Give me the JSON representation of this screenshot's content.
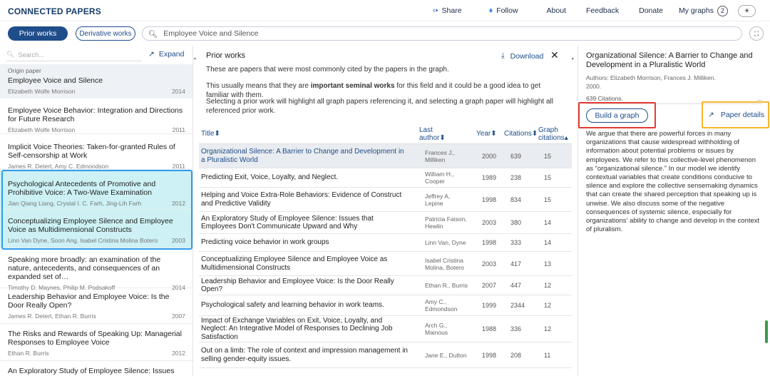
{
  "header": {
    "logo": "CONNECTED PAPERS",
    "share": "Share",
    "follow": "Follow",
    "about": "About",
    "feedback": "Feedback",
    "donate": "Donate",
    "my_graphs": "My graphs",
    "my_graphs_count": "2"
  },
  "toolbar": {
    "prior_works": "Prior works",
    "derivative_works": "Derivative works",
    "search_value": "Employee Voice and Silence"
  },
  "left": {
    "search_placeholder": "Search...",
    "expand": "Expand",
    "origin": {
      "label": "Origin paper",
      "title": "Employee Voice and Silence",
      "author": "Elizabeth Wolfe Morrison",
      "year": "2014"
    },
    "papers": [
      {
        "title": "Employee Voice Behavior: Integration and Directions for Future Research",
        "author": "Elizabeth Wolfe Morrison",
        "year": "2011"
      },
      {
        "title": "Implicit Voice Theories: Taken-for-granted Rules of Self-censorship at Work",
        "author": "James R. Detert, Amy C. Edmondson",
        "year": "2011"
      },
      {
        "title": "Psychological Antecedents of Promotive and Prohibitive Voice: A Two-Wave Examination",
        "author": "Jian Qiang Liang, Crystal I. C. Farh, Jing-Lih Farh",
        "year": "2012"
      },
      {
        "title": "Conceptualizing Employee Silence and Employee Voice as Multidimensional Constructs",
        "author": "Linn Van Dyne, Soon Ang, Isabel Cristina Molina Botero",
        "year": "2003"
      },
      {
        "title": "Speaking more broadly: an examination of the nature, antecedents, and consequences of an expanded set of…",
        "author": "Timothy D. Maynes, Philip M. Podsakoff",
        "year": "2014"
      },
      {
        "title": "Leadership Behavior and Employee Voice: Is the Door Really Open?",
        "author": "James R. Detert, Ethan R. Burris",
        "year": "2007"
      },
      {
        "title": "The Risks and Rewards of Speaking Up: Managerial Responses to Employee Voice",
        "author": "Ethan R. Burris",
        "year": "2012"
      },
      {
        "title": "An Exploratory Study of Employee Silence: Issues that",
        "author": "",
        "year": ""
      }
    ]
  },
  "mid": {
    "title": "Prior works",
    "download": "Download",
    "p1": "These are papers that were most commonly cited by the papers in the graph.",
    "p2_before": "This usually means that they are ",
    "p2_bold": "important seminal works",
    "p2_after": " for this field and it could be a good idea to get familiar with them.",
    "p3": "Selecting a prior work will highlight all graph papers referencing it, and selecting a graph paper will highlight all referenced prior work.",
    "columns": {
      "title": "Title",
      "author": "Last author",
      "year": "Year",
      "citations": "Citations",
      "graph": "Graph citations"
    },
    "rows": [
      {
        "title": "Organizational Silence: A Barrier to Change and Development in a Pluralistic World",
        "author": "Frances J., Milliken",
        "year": "2000",
        "citations": "639",
        "graph": "15"
      },
      {
        "title": "Predicting Exit, Voice, Loyalty, and Neglect.",
        "author": "William H., Cooper",
        "year": "1989",
        "citations": "238",
        "graph": "15"
      },
      {
        "title": "Helping and Voice Extra-Role Behaviors: Evidence of Construct and Predictive Validity",
        "author": "Jeffrey A, Lepine",
        "year": "1998",
        "citations": "834",
        "graph": "15"
      },
      {
        "title": "An Exploratory Study of Employee Silence: Issues that Employees Don't Communicate Upward and Why",
        "author": "Patricia Faison, Hewlin",
        "year": "2003",
        "citations": "380",
        "graph": "14"
      },
      {
        "title": "Predicting voice behavior in work groups",
        "author": "Linn Van, Dyne",
        "year": "1998",
        "citations": "333",
        "graph": "14"
      },
      {
        "title": "Conceptualizing Employee Silence and Employee Voice as Multidimensional Constructs",
        "author": "Isabel Cristina Molina, Botero",
        "year": "2003",
        "citations": "417",
        "graph": "13"
      },
      {
        "title": "Leadership Behavior and Employee Voice: Is the Door Really Open?",
        "author": "Ethan R., Burris",
        "year": "2007",
        "citations": "447",
        "graph": "12"
      },
      {
        "title": "Psychological safety and learning behavior in work teams.",
        "author": "Amy C., Edmondson",
        "year": "1999",
        "citations": "2344",
        "graph": "12"
      },
      {
        "title": "Impact of Exchange Variables on Exit, Voice, Loyalty, and Neglect: An Integrative Model of Responses to Declining Job Satisfaction",
        "author": "Arch G., Mainous",
        "year": "1988",
        "citations": "336",
        "graph": "12"
      },
      {
        "title": "Out on a limb: The role of context and impression management in selling gender-equity issues.",
        "author": "Jane E., Dutton",
        "year": "1998",
        "citations": "208",
        "graph": "11"
      }
    ]
  },
  "right": {
    "title": "Organizational Silence: A Barrier to Change and Development in a Pluralistic World",
    "authors": "Authors: Elizabeth Morrison, Frances J. Milliken.",
    "year": "2000.",
    "citations": "639 Citations.",
    "more": "...",
    "build": "Build a graph",
    "details": "Paper details",
    "abstract": "We argue that there are powerful forces in many organizations that cause widespread withholding of information about potential problems or issues by employees. We refer to this collective-level phenomenon as “organizational silence.” In our model we identify contextual variables that create conditions conducive to silence and explore the collective sensemaking dynamics that can create the shared perception that speaking up is unwise. We also discuss some of the negative consequences of systemic silence, especially for organizations' ability to change and develop in the context of pluralism."
  },
  "colors": {
    "brand": "#1f4d8a",
    "highlight": "#cdf1f4",
    "red_box": "#e33b35",
    "yellow_box": "#f4b72b",
    "blue_box": "#2e9cf0"
  }
}
